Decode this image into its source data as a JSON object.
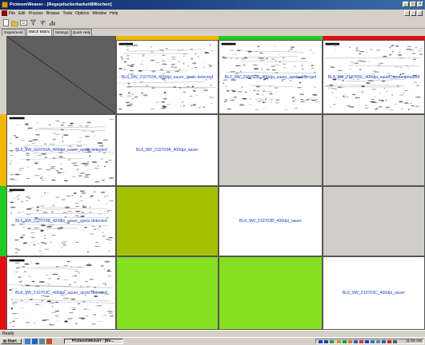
{
  "window": {
    "title": "ProteomWeaver - [Regepduckerbarkeit8Wochen]",
    "controls": [
      "_",
      "□",
      "×"
    ]
  },
  "menu": {
    "items": [
      "File",
      "Edit",
      "Process",
      "Browse",
      "Tools",
      "Options",
      "Window",
      "Help"
    ]
  },
  "toolbar": {
    "tools": [
      "new-icon",
      "open-icon",
      "properties-icon",
      "filter-icon",
      "compare-icon",
      "histogram-icon"
    ]
  },
  "tabs": [
    {
      "label": "Experiment"
    },
    {
      "label": "Match Matrix",
      "active": true
    },
    {
      "label": "Settings"
    },
    {
      "label": "Quick Help"
    }
  ],
  "matrix": {
    "column_gels": [
      {
        "label": "BL6_8W_210703A_400dpi_sauer_spots detected",
        "color": "#f0b800"
      },
      {
        "label": "BL6_8W_210703B_400dpi_sauer_spots detected",
        "color": "#22cc22"
      },
      {
        "label": "BL6_8W_210703C_400dpi_sauer_spots detected",
        "color": "#dd1111"
      }
    ],
    "row_gels": [
      {
        "label": "BL6_8W_210703A_400dpi_sauer_spots detected",
        "color": "#f0b800"
      },
      {
        "label": "BL6_8W_210703B_400dpi_sauer_spots detected",
        "color": "#22cc22"
      },
      {
        "label": "BL6_8W_210703C_400dpi_sauer_spots detected",
        "color": "#dd1111"
      }
    ],
    "diagonal_labels": [
      "BL6_8W_210703A_400dpi_sauer",
      "BL6_8W_210703B_400dpi_sauer",
      "BL6_8W_210703C_400dpi_sauer"
    ],
    "cell_colors": {
      "upper": "#d1cec8",
      "diagonal": "#ffffff",
      "lower_b_a": "#a5c000",
      "lower_c_a": "#86e020",
      "lower_c_b": "#86e020"
    }
  },
  "status": {
    "text": "Ready"
  },
  "taskbar": {
    "start_label": "Start",
    "task_label": "ProteomWeaver - [Re...",
    "clock": "11:59 AM"
  }
}
